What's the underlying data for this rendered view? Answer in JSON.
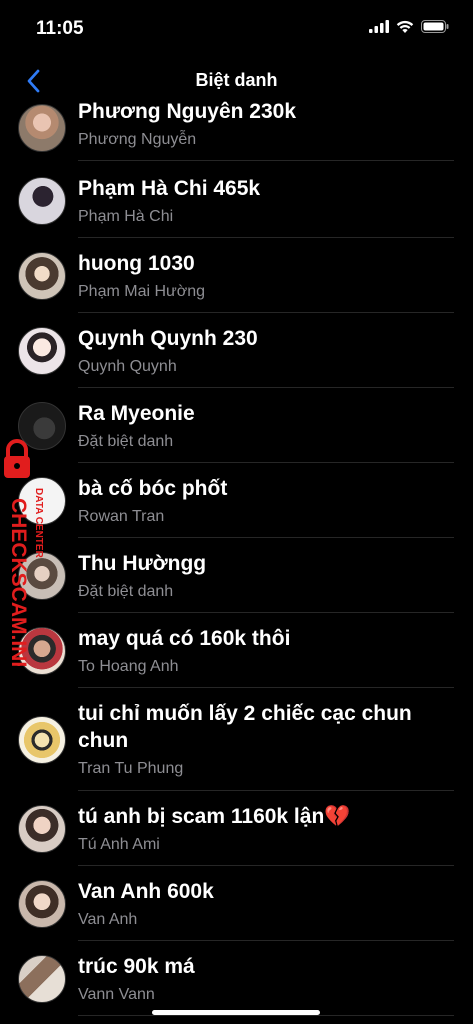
{
  "status": {
    "time": "11:05"
  },
  "nav": {
    "title": "Biệt danh"
  },
  "contacts": [
    {
      "nickname": "Phương Nguyên 230k",
      "name": "Phương Nguyễn"
    },
    {
      "nickname": "Phạm Hà Chi 465k",
      "name": "Phạm Hà Chi"
    },
    {
      "nickname": "huong 1030",
      "name": "Phạm Mai Hường"
    },
    {
      "nickname": "Quynh Quynh 230",
      "name": "Quynh Quynh"
    },
    {
      "nickname": "Ra Myeonie",
      "name": "Đặt biệt danh"
    },
    {
      "nickname": "bà cố bóc phốt",
      "name": "Rowan Tran"
    },
    {
      "nickname": "Thu Hườngg",
      "name": "Đặt biệt danh"
    },
    {
      "nickname": "may quá có 160k thôi",
      "name": "To Hoang Anh"
    },
    {
      "nickname": "tui chỉ muốn lấy 2 chiếc cạc chun chun",
      "name": "Tran Tu Phung"
    },
    {
      "nickname": "tú anh bị scam 1160k lận💔",
      "name": "Tú Anh Ami"
    },
    {
      "nickname": "Van Anh 600k",
      "name": "Van Anh"
    },
    {
      "nickname": "trúc 90k má",
      "name": "Vann Vann"
    }
  ],
  "watermark": {
    "text": "CHECKSCAM.INFO",
    "subtext": "DATA CENTER"
  },
  "colors": {
    "background": "#000000",
    "accent": "#2f7bf6",
    "secondary_text": "#8e8e93",
    "watermark": "#e11d1d"
  }
}
